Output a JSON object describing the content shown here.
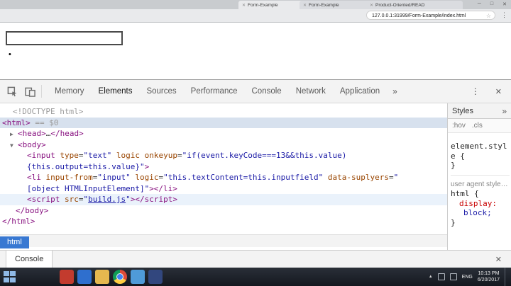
{
  "colors": {
    "devtools_accent_blue": "#3878d2",
    "selected_row": "#d7e1ee",
    "highlight_row": "#eaf2fb",
    "syntax_tag": "#881280",
    "syntax_attr": "#994500",
    "syntax_value": "#1a1aa6",
    "css_property": "#c80000"
  },
  "icons": {
    "tab_close": "✕",
    "minimize": "─",
    "maximize": "□",
    "close": "✕",
    "star": "☆",
    "menu": "⋮",
    "more_tabs": "»",
    "tray_expand": "▲"
  },
  "browser": {
    "tabs": [
      {
        "label": "Form-Example"
      },
      {
        "label": "Form-Example"
      },
      {
        "label": "Product-Oriented/READ"
      }
    ],
    "url": "127.0.0.1:31999/Form-Example/index.html"
  },
  "page": {
    "list_bullet": "•"
  },
  "devtools": {
    "tabs": [
      "Memory",
      "Elements",
      "Sources",
      "Performance",
      "Console",
      "Network",
      "Application"
    ],
    "active_tab": "Elements",
    "breadcrumb": [
      "html"
    ],
    "console_drawer": {
      "label": "Console"
    },
    "styles": {
      "tab_label": "Styles",
      "filters": [
        ":hov",
        ".cls"
      ],
      "element_style_open": "element.style {",
      "element_style_close": "}",
      "rule_origin": "user agent stylesheet",
      "rule_open": "html {",
      "property": "display:",
      "value": "block;",
      "rule_close": "}"
    },
    "tree": {
      "lines": [
        {
          "indent": 18,
          "seg": [
            {
              "c": "dim",
              "t": "<!DOCTYPE html>"
            }
          ]
        },
        {
          "indent": 3,
          "hl": "sel",
          "seg": [
            {
              "c": "tag",
              "t": "<html>"
            },
            {
              "c": "dim",
              "t": " == $0"
            }
          ]
        },
        {
          "indent": 14,
          "arrow": "▶",
          "seg": [
            {
              "c": "tag",
              "t": "<head>"
            },
            {
              "c": "plain",
              "t": "…"
            },
            {
              "c": "tag",
              "t": "</head>"
            }
          ]
        },
        {
          "indent": 14,
          "arrow": "▼",
          "seg": [
            {
              "c": "tag",
              "t": "<body>"
            }
          ]
        },
        {
          "indent": 38,
          "seg": [
            {
              "c": "tag",
              "t": "<input"
            },
            {
              "c": "attr",
              "t": " type"
            },
            {
              "c": "plain",
              "t": "="
            },
            {
              "c": "val",
              "t": "\"text\""
            },
            {
              "c": "attr",
              "t": " logic onkeyup"
            },
            {
              "c": "plain",
              "t": "="
            },
            {
              "c": "val",
              "t": "\"if(event.keyCode===13&&this.value)"
            }
          ]
        },
        {
          "indent": 38,
          "seg": [
            {
              "c": "val",
              "t": "{this.output=this.value}\""
            },
            {
              "c": "tag",
              "t": ">"
            }
          ]
        },
        {
          "indent": 38,
          "seg": [
            {
              "c": "tag",
              "t": "<li"
            },
            {
              "c": "attr",
              "t": " input-from"
            },
            {
              "c": "plain",
              "t": "="
            },
            {
              "c": "val",
              "t": "\"input\""
            },
            {
              "c": "attr",
              "t": " logic"
            },
            {
              "c": "plain",
              "t": "="
            },
            {
              "c": "val",
              "t": "\"this.textContent=this.inputfield\""
            },
            {
              "c": "attr",
              "t": " data-suplyers"
            },
            {
              "c": "plain",
              "t": "="
            },
            {
              "c": "val",
              "t": "\""
            }
          ]
        },
        {
          "indent": 38,
          "seg": [
            {
              "c": "val",
              "t": "[object HTMLInputElement]\""
            },
            {
              "c": "tag",
              "t": "></li>"
            }
          ]
        },
        {
          "indent": 38,
          "hl": "row",
          "seg": [
            {
              "c": "tag",
              "t": "<script"
            },
            {
              "c": "attr",
              "t": " src"
            },
            {
              "c": "plain",
              "t": "="
            },
            {
              "c": "val",
              "t": "\""
            },
            {
              "c": "link",
              "t": "build.js"
            },
            {
              "c": "val",
              "t": "\""
            },
            {
              "c": "tag",
              "t": "></script>"
            }
          ]
        },
        {
          "indent": 22,
          "seg": [
            {
              "c": "tag",
              "t": "</body>"
            }
          ]
        },
        {
          "indent": 3,
          "seg": [
            {
              "c": "tag",
              "t": "</html>"
            }
          ]
        }
      ]
    }
  },
  "taskbar": {
    "apps": [
      {
        "name": "pinned-app-red",
        "color": "#c33b2e"
      },
      {
        "name": "pinned-app-blue",
        "color": "#2f6fce"
      },
      {
        "name": "pinned-app-folder",
        "color": "#e6b84f"
      },
      {
        "name": "pinned-app-chrome",
        "chrome": true
      },
      {
        "name": "pinned-app-lightblue",
        "color": "#4f9bd8"
      },
      {
        "name": "pinned-app-navy",
        "color": "#32477e"
      }
    ],
    "tray": {
      "lang": "ENG",
      "time": "10:13 PM",
      "date": "6/20/2017"
    }
  }
}
